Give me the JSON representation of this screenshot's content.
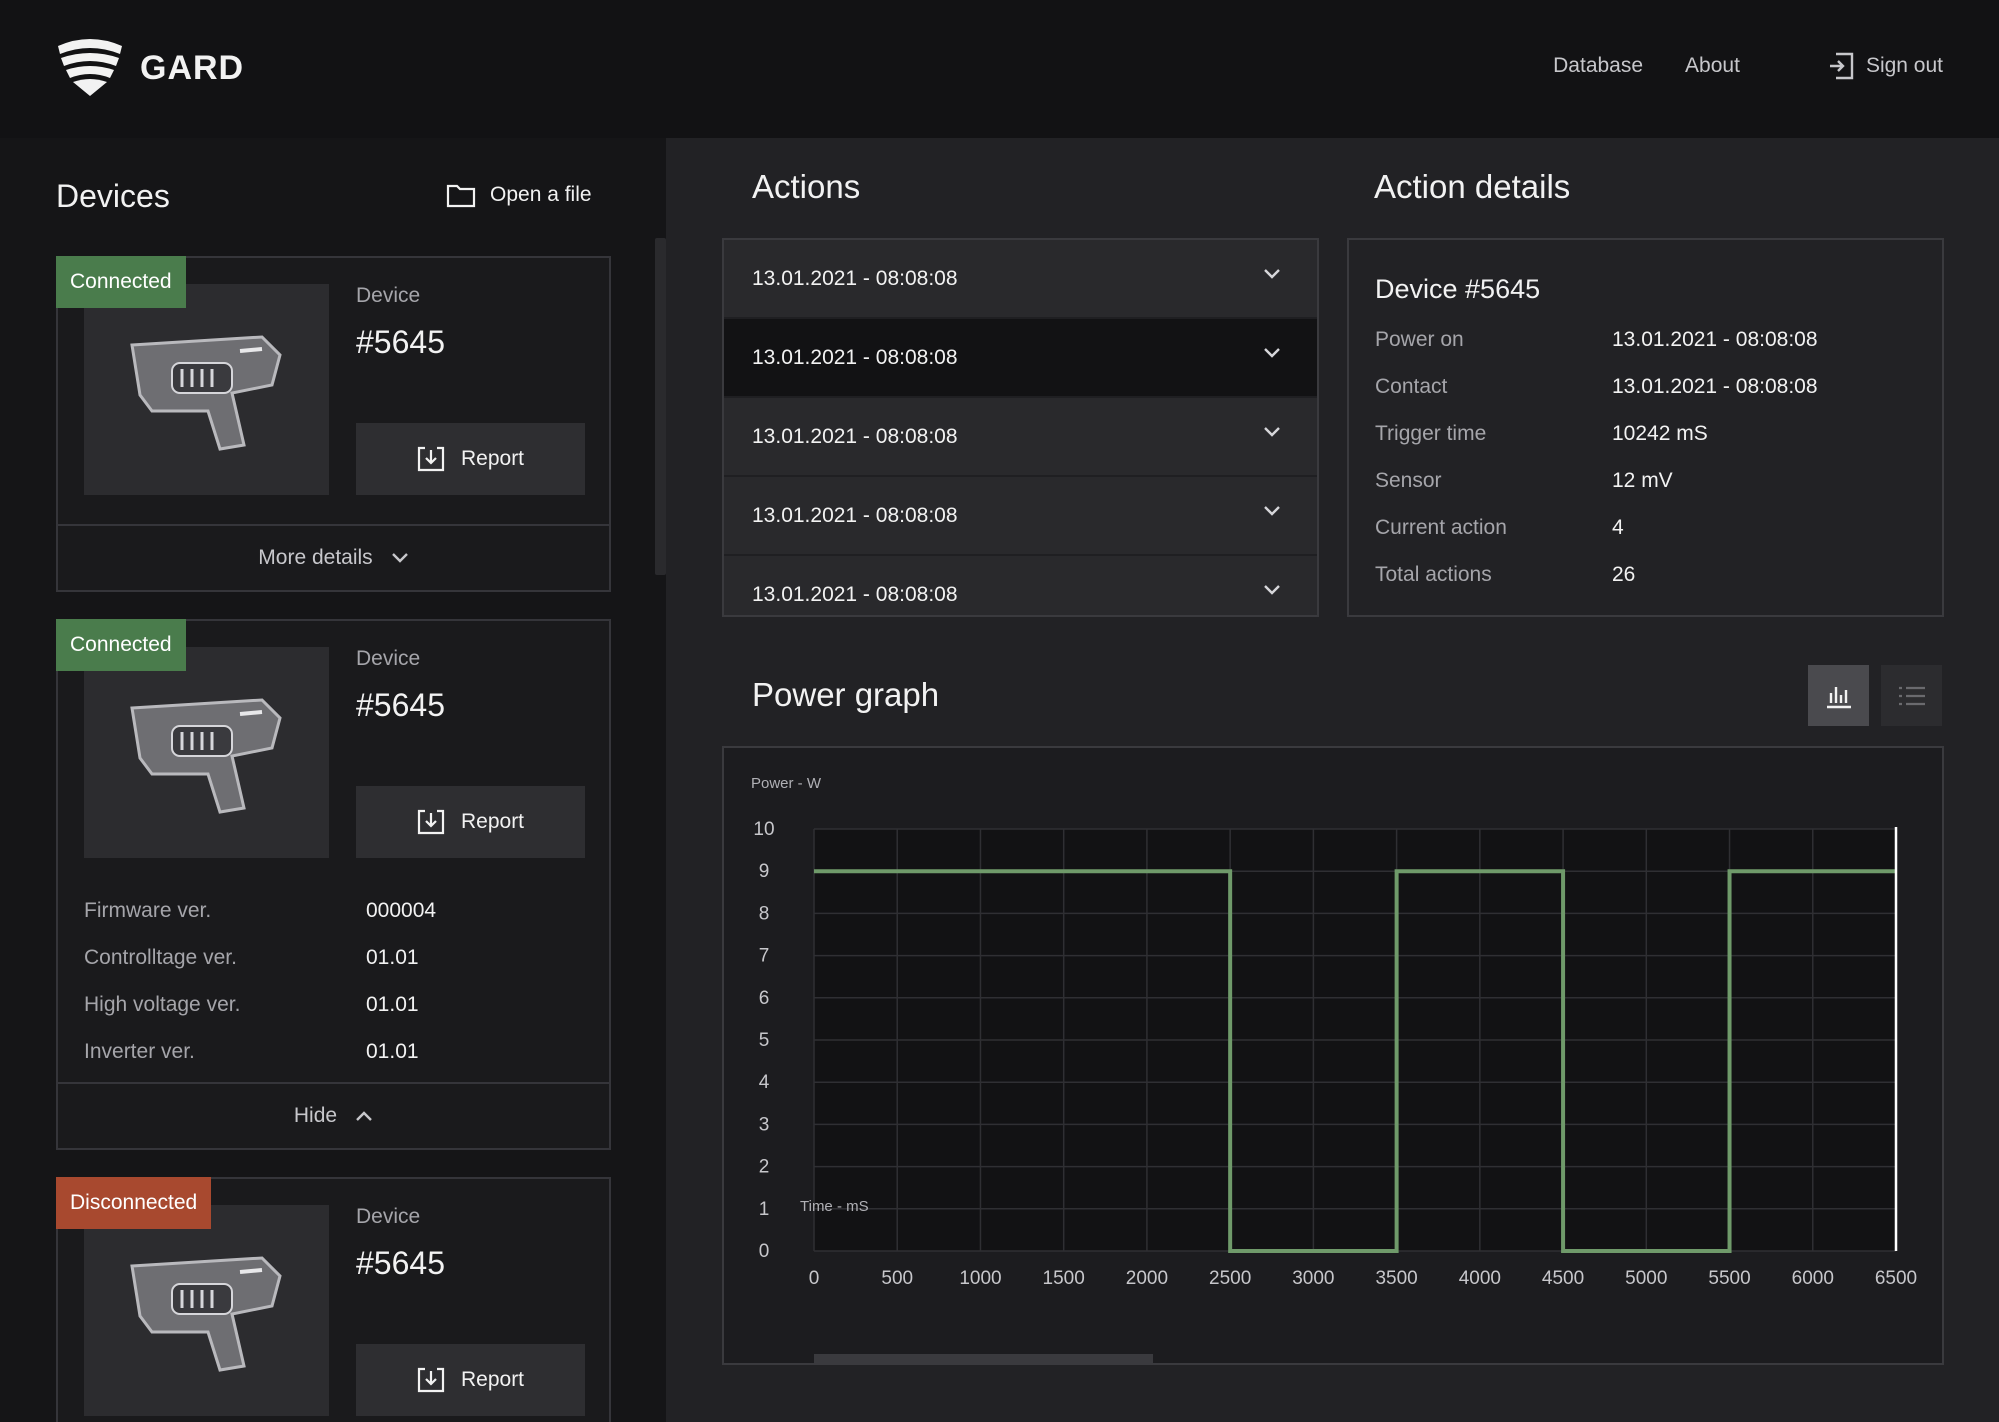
{
  "header": {
    "brand": "GARD",
    "nav": {
      "database": "Database",
      "about": "About",
      "sign_out": "Sign out"
    }
  },
  "devices": {
    "title": "Devices",
    "open_file": "Open a file",
    "cards": [
      {
        "status": "Connected",
        "label": "Device",
        "id": "#5645",
        "report": "Report",
        "toggle": "More details"
      },
      {
        "status": "Connected",
        "label": "Device",
        "id": "#5645",
        "report": "Report",
        "toggle": "Hide",
        "specs": [
          {
            "k": "Firmware ver.",
            "v": "000004"
          },
          {
            "k": "Controlltage ver.",
            "v": "01.01"
          },
          {
            "k": "High voltage ver.",
            "v": "01.01"
          },
          {
            "k": "Inverter ver.",
            "v": "01.01"
          }
        ]
      },
      {
        "status": "Disconnected",
        "label": "Device",
        "id": "#5645",
        "report": "Report"
      }
    ]
  },
  "actions": {
    "title": "Actions",
    "items": [
      "13.01.2021 - 08:08:08",
      "13.01.2021 - 08:08:08",
      "13.01.2021 - 08:08:08",
      "13.01.2021 - 08:08:08",
      "13.01.2021 - 08:08:08"
    ]
  },
  "action_details": {
    "title": "Action details",
    "device": "Device #5645",
    "rows": [
      {
        "k": "Power on",
        "v": "13.01.2021 - 08:08:08"
      },
      {
        "k": "Contact",
        "v": "13.01.2021 - 08:08:08"
      },
      {
        "k": "Trigger time",
        "v": "10242 mS"
      },
      {
        "k": "Sensor",
        "v": "12 mV"
      },
      {
        "k": "Current action",
        "v": "4"
      },
      {
        "k": "Total actions",
        "v": "26"
      }
    ]
  },
  "power_graph": {
    "title": "Power graph"
  },
  "colors": {
    "connected": "#4a7c4c",
    "disconnected": "#a8492f",
    "series": "#6f9a6a"
  },
  "chart_data": {
    "type": "line",
    "ylabel": "Power - W",
    "xlabel": "Time - mS",
    "xlim": [
      0,
      6500
    ],
    "ylim": [
      0,
      10
    ],
    "xticks": [
      0,
      500,
      1000,
      1500,
      2000,
      2500,
      3000,
      3500,
      4000,
      4500,
      5000,
      5500,
      6000,
      6500
    ],
    "yticks": [
      0,
      1,
      2,
      3,
      4,
      5,
      6,
      7,
      8,
      9,
      10
    ],
    "grid": true,
    "series": [
      {
        "x": [
          0,
          2500,
          2500,
          3500,
          3500,
          4500,
          4500,
          5500,
          5500,
          6500
        ],
        "y": [
          9,
          9,
          0,
          0,
          9,
          9,
          0,
          0,
          9,
          9
        ]
      }
    ]
  }
}
